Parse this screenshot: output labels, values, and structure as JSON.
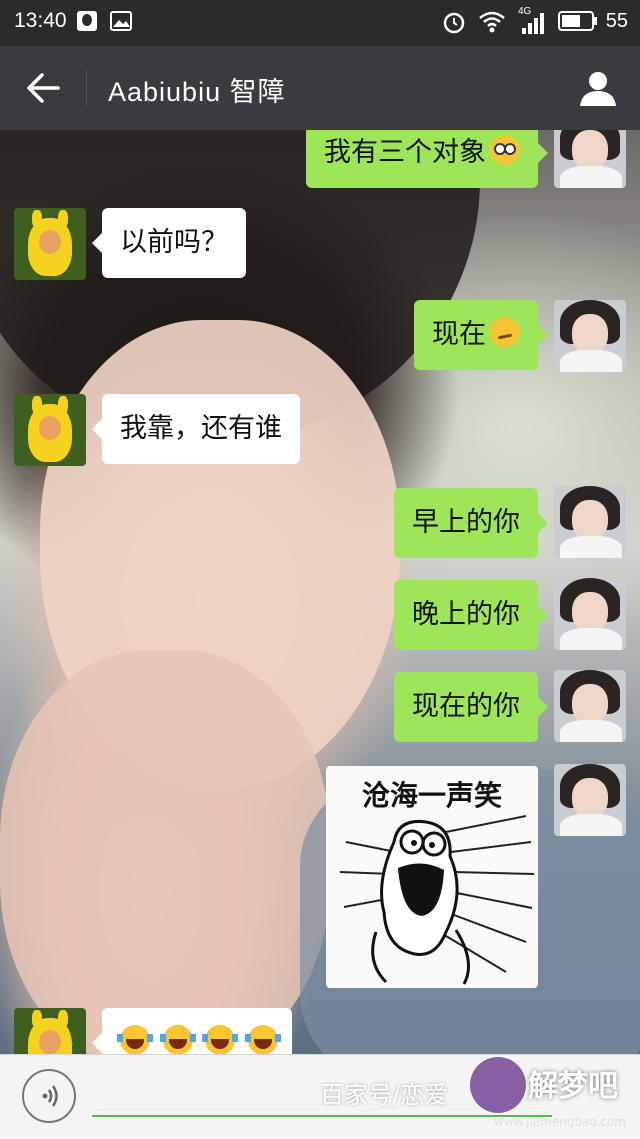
{
  "status_bar": {
    "time": "13:40",
    "network": "4G",
    "battery": "55"
  },
  "header": {
    "title": "Aabiubiu  智障"
  },
  "messages": [
    {
      "side": "right",
      "text": "我有三个对象",
      "emoji": "flushed-face"
    },
    {
      "side": "left",
      "text": "以前吗？"
    },
    {
      "side": "right",
      "text": "现在",
      "emoji": "smirking-face"
    },
    {
      "side": "left",
      "text": "我靠，还有谁"
    },
    {
      "side": "right",
      "text": "早上的你"
    },
    {
      "side": "right",
      "text": "晚上的你"
    },
    {
      "side": "right",
      "text": "现在的你"
    },
    {
      "side": "right",
      "type": "sticker",
      "text": "沧海一声笑"
    },
    {
      "side": "left",
      "emoji": "tears-of-joy x4"
    }
  ],
  "watermark": {
    "text": "百家号/恋爱",
    "logo": "解梦吧",
    "url": "www.jiemengbao.com"
  },
  "colors": {
    "outgoing_bubble": "#9fe55a",
    "incoming_bubble": "#ffffff",
    "title_bar": "#3a3b3e"
  }
}
